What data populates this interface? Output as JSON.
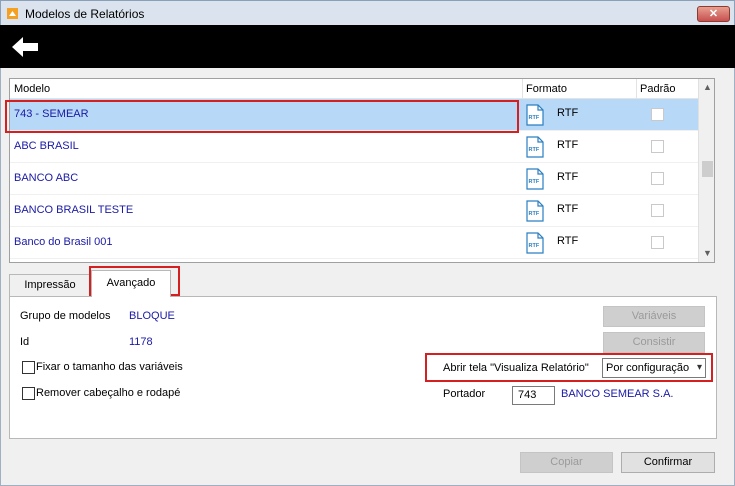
{
  "window": {
    "title": "Modelos de Relatórios",
    "close_label": "✕"
  },
  "grid": {
    "columns": [
      "Modelo",
      "Formato",
      "Padrão"
    ],
    "rows": [
      {
        "name": "743 - SEMEAR",
        "format": "RTF",
        "default": false,
        "selected": true
      },
      {
        "name": "ABC BRASIL",
        "format": "RTF",
        "default": false,
        "selected": false
      },
      {
        "name": "BANCO ABC",
        "format": "RTF",
        "default": false,
        "selected": false
      },
      {
        "name": "BANCO BRASIL TESTE",
        "format": "RTF",
        "default": false,
        "selected": false
      },
      {
        "name": "Banco do Brasil 001",
        "format": "RTF",
        "default": false,
        "selected": false
      }
    ],
    "icon_text": "RTF"
  },
  "tabs": [
    {
      "label": "Impressão",
      "active": false
    },
    {
      "label": "Avançado",
      "active": true
    }
  ],
  "advanced": {
    "grupo_label": "Grupo de modelos",
    "grupo_value": "BLOQUE",
    "id_label": "Id",
    "id_value": "1178",
    "fixar_label": "Fixar o tamanho das variáveis",
    "fixar_checked": false,
    "remover_label": "Remover cabeçalho e rodapé",
    "remover_checked": false,
    "variaveis_button": "Variáveis",
    "consistir_button": "Consistir",
    "abrir_label": "Abrir tela \"Visualiza Relatório\"",
    "abrir_value": "Por configuração",
    "portador_label": "Portador",
    "portador_code": "743",
    "portador_name": "BANCO SEMEAR S.A."
  },
  "footer": {
    "copiar": "Copiar",
    "confirmar": "Confirmar"
  },
  "colors": {
    "highlight": "#d42020",
    "selected_row": "#b7d8f7",
    "link_text": "#1a1aa6"
  }
}
